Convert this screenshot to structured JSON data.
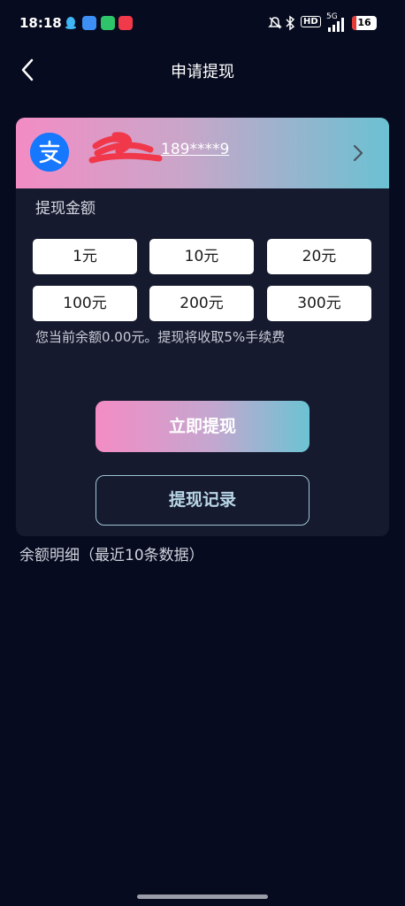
{
  "status_bar": {
    "time": "18:18",
    "hd": "HD",
    "network": "5G",
    "battery": "16",
    "app_icons": [
      "qq-icon",
      "browser-icon",
      "app-green-icon",
      "app-red-icon"
    ]
  },
  "header": {
    "title": "申请提现"
  },
  "account": {
    "masked_number": "189****9"
  },
  "amount_section": {
    "label": "提现金额",
    "options": [
      "1元",
      "10元",
      "20元",
      "100元",
      "200元",
      "300元"
    ],
    "note": "您当前余额0.00元。提现将收取5%手续费"
  },
  "actions": {
    "withdraw": "立即提现",
    "records": "提现记录"
  },
  "balance_detail": {
    "label": "余额明细（最近10条数据）"
  },
  "colors": {
    "background": "#070b1f",
    "card": "#161a2e",
    "gradient_start": "#f38cc4",
    "gradient_end": "#6bc1d2",
    "alipay_blue": "#1677ff"
  }
}
